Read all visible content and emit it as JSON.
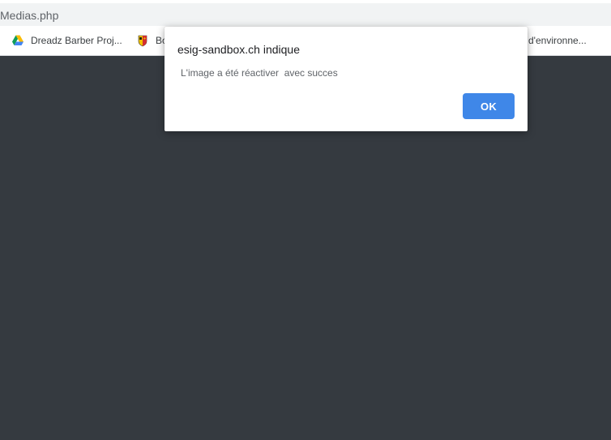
{
  "browser": {
    "url_text": "Medias.php"
  },
  "bookmarks": [
    {
      "label": "Dreadz Barber Proj...",
      "icon": "google-drive-icon"
    },
    {
      "label": "Bo",
      "icon": "geneva-crest-icon"
    },
    {
      "label": "d'environne..."
    }
  ],
  "dialog": {
    "title": "esig-sandbox.ch indique",
    "message": "L'image a été réactiver  avec succes",
    "ok_label": "OK"
  },
  "colors": {
    "page_background": "#353a40",
    "button_blue": "#3f87e8"
  }
}
